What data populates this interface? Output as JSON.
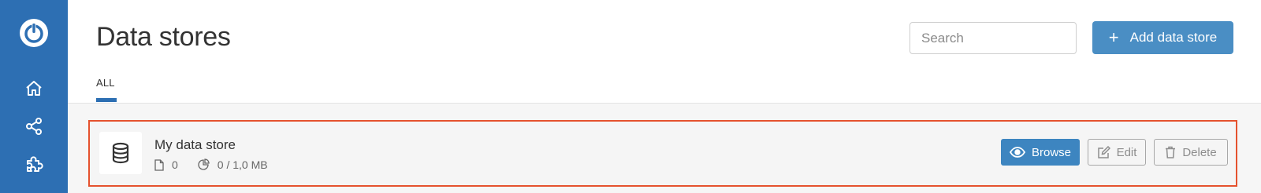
{
  "sidebar": {
    "logo": "power-logo",
    "items": [
      {
        "name": "home",
        "icon": "home-icon"
      },
      {
        "name": "share",
        "icon": "share-icon"
      },
      {
        "name": "plugins",
        "icon": "puzzle-icon"
      }
    ]
  },
  "header": {
    "title": "Data stores",
    "search_placeholder": "Search",
    "add_button_label": "Add data store",
    "add_icon": "+",
    "tabs": [
      {
        "label": "ALL",
        "active": true
      }
    ]
  },
  "stores": [
    {
      "name": "My data store",
      "icon": "database-icon",
      "file_count": "0",
      "usage": "0 / 1,0 MB",
      "actions": {
        "browse": "Browse",
        "edit": "Edit",
        "delete": "Delete"
      }
    }
  ],
  "colors": {
    "sidebar": "#2d6fb3",
    "primary_button": "#4a8ec4",
    "highlight_border": "#e5522e"
  }
}
